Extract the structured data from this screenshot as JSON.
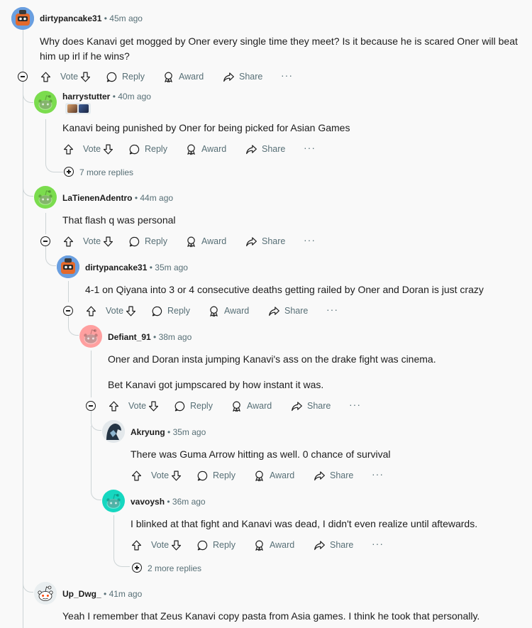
{
  "actions": {
    "vote": "Vote",
    "reply": "Reply",
    "award": "Award",
    "share": "Share",
    "more": "···"
  },
  "colors": {
    "snoo_green": "#7bdc4e",
    "snoo_pink": "#ff9f9f",
    "snoo_teal": "#16d7c0",
    "meta_gray": "#576f76",
    "thread_line": "#cdd4d6"
  },
  "comments": [
    {
      "user": "dirtypancake31",
      "time": "• 45m ago",
      "avatar": "custom-avatar",
      "lines": [
        "Why does Kanavi get mogged by Oner every single time they meet? Is it because he is scared Oner will beat",
        "him up irl if he wins?"
      ]
    },
    {
      "user": "harrystutter",
      "time": "• 40m ago",
      "avatar": "snoo-green",
      "flair": "image-flair",
      "lines": [
        "Kanavi being punished by Oner for being picked for Asian Games"
      ],
      "more_replies": "7 more replies"
    },
    {
      "user": "LaTienenAdentro",
      "time": "• 44m ago",
      "avatar": "snoo-green",
      "lines": [
        "That flash q was personal"
      ]
    },
    {
      "user": "dirtypancake31",
      "time": "• 35m ago",
      "avatar": "custom-avatar",
      "lines": [
        "4-1 on Qiyana into 3 or 4 consecutive deaths getting railed by Oner and Doran is just crazy"
      ]
    },
    {
      "user": "Defiant_91",
      "time": "• 38m ago",
      "avatar": "snoo-pink",
      "lines": [
        "Oner and Doran insta jumping Kanavi's ass on the drake fight was cinema.",
        "Bet Kanavi got jumpscared by how instant it was."
      ]
    },
    {
      "user": "Akryung",
      "time": "• 35m ago",
      "avatar": "custom-avatar-dark",
      "lines": [
        "There was Guma Arrow hitting as well. 0 chance of survival"
      ]
    },
    {
      "user": "vavoysh",
      "time": "• 36m ago",
      "avatar": "snoo-teal",
      "lines": [
        "I blinked at that fight and Kanavi was dead, I didn't even realize until aftewards."
      ],
      "more_replies": "2 more replies"
    },
    {
      "user": "Up_Dwg_",
      "time": "• 41m ago",
      "avatar": "snoo-default",
      "lines": [
        "Yeah I remember that Zeus Kanavi copy pasta from Asia games. I think he took that personally."
      ]
    }
  ]
}
